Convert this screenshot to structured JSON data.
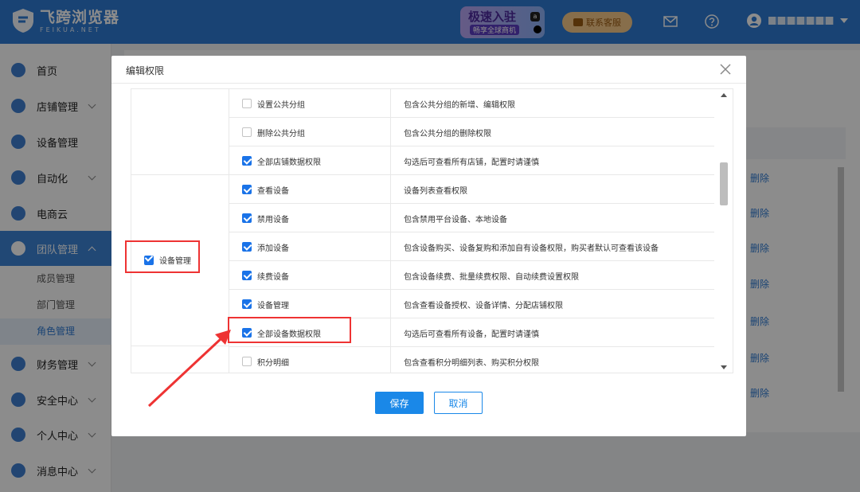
{
  "header": {
    "logo_title": "飞跨浏览器",
    "logo_sub": "FEIKUA.NET",
    "promo_title": "极速入驻",
    "promo_sub": "畅享全球商机",
    "contact_label": "联系客服"
  },
  "sidebar": {
    "items": [
      {
        "label": "首页"
      },
      {
        "label": "店铺管理"
      },
      {
        "label": "设备管理"
      },
      {
        "label": "自动化"
      },
      {
        "label": "电商云"
      },
      {
        "label": "团队管理"
      },
      {
        "label": "财务管理"
      },
      {
        "label": "安全中心"
      },
      {
        "label": "个人中心"
      },
      {
        "label": "消息中心"
      }
    ],
    "team_sub": [
      {
        "label": "成员管理"
      },
      {
        "label": "部门管理"
      },
      {
        "label": "角色管理"
      }
    ]
  },
  "background": {
    "delete_label": "删除"
  },
  "modal": {
    "title": "编辑权限",
    "category_label": "设备管理",
    "permissions": [
      {
        "name": "设置公共分组",
        "desc": "包含公共分组的新增、编辑权限",
        "checked": false
      },
      {
        "name": "删除公共分组",
        "desc": "包含公共分组的删除权限",
        "checked": false
      },
      {
        "name": "全部店铺数据权限",
        "desc": "勾选后可查看所有店铺，配置时请谨慎",
        "checked": true
      },
      {
        "name": "查看设备",
        "desc": "设备列表查看权限",
        "checked": true
      },
      {
        "name": "禁用设备",
        "desc": "包含禁用平台设备、本地设备",
        "checked": true
      },
      {
        "name": "添加设备",
        "desc": "包含设备购买、设备复购和添加自有设备权限，购买者默认可查看该设备",
        "checked": true
      },
      {
        "name": "续费设备",
        "desc": "包含设备续费、批量续费权限、自动续费设置权限",
        "checked": true
      },
      {
        "name": "设备管理",
        "desc": "包含查看设备授权、设备详情、分配店铺权限",
        "checked": true
      },
      {
        "name": "全部设备数据权限",
        "desc": "勾选后可查看所有设备，配置时请谨慎",
        "checked": true
      },
      {
        "name": "积分明细",
        "desc": "包含查看积分明细列表、购买积分权限",
        "checked": false
      }
    ],
    "save_label": "保存",
    "cancel_label": "取消"
  }
}
